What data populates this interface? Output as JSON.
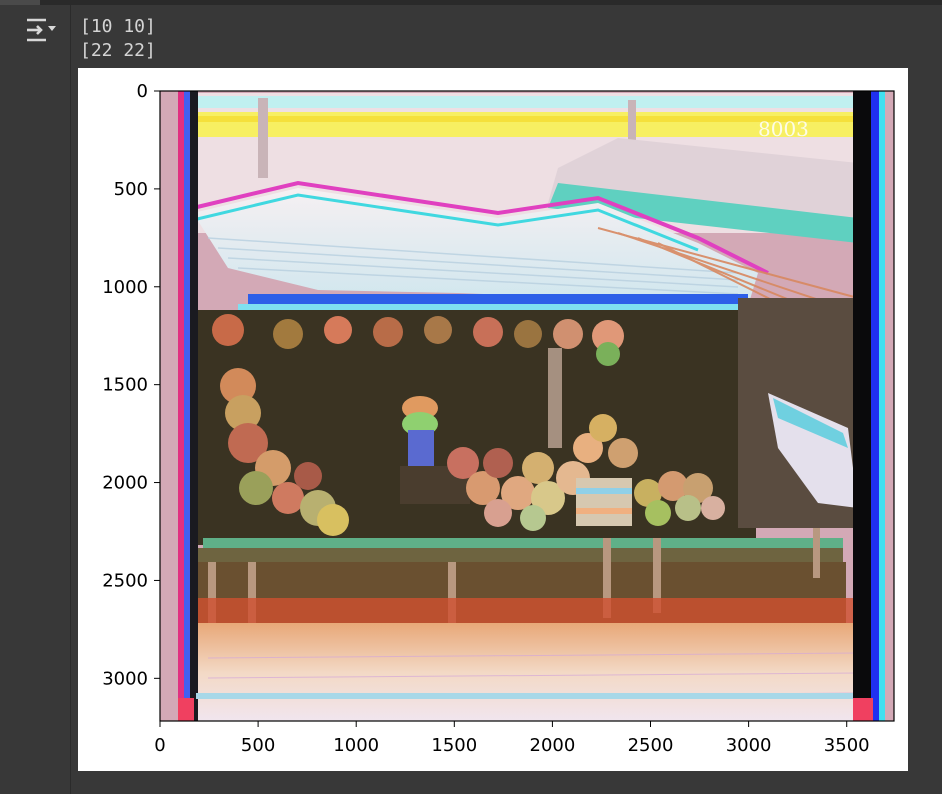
{
  "output": {
    "icon": "output-toggle-icon",
    "lines": [
      "[10 10]",
      "[22 22]"
    ]
  },
  "plot": {
    "type": "image",
    "x_ticks": [
      "0",
      "500",
      "1000",
      "1500",
      "2000",
      "2500",
      "3000",
      "3500"
    ],
    "y_ticks": [
      "0",
      "500",
      "1000",
      "1500",
      "2000",
      "2500",
      "3000"
    ],
    "xlim": [
      0,
      3741
    ],
    "ylim": [
      3218,
      0
    ],
    "image_watermark_text": "8003"
  },
  "chart_data": {
    "type": "image",
    "x_tick_values": [
      0,
      500,
      1000,
      1500,
      2000,
      2500,
      3000,
      3500
    ],
    "y_tick_values": [
      0,
      500,
      1000,
      1500,
      2000,
      2500,
      3000
    ],
    "xlim": [
      0,
      3741
    ],
    "ylim": [
      3218,
      0
    ],
    "grid": false
  }
}
